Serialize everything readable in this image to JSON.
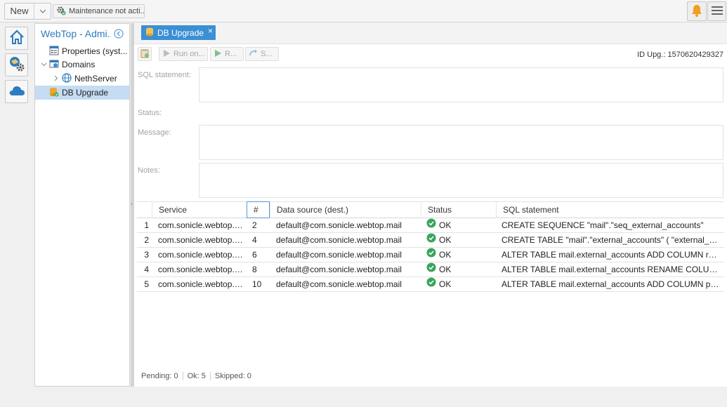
{
  "toolbar": {
    "new_label": "New",
    "maintenance_label": "Maintenance not acti..."
  },
  "launcher": {
    "items": [
      {
        "name": "home-icon"
      },
      {
        "name": "admin-icon"
      },
      {
        "name": "cloud-icon"
      }
    ]
  },
  "tree": {
    "title": "WebTop - Admi...",
    "nodes": [
      {
        "label": "Properties (syst...",
        "icon": "properties-icon"
      },
      {
        "label": "Domains",
        "icon": "domains-icon"
      },
      {
        "label": "NethServer",
        "icon": "globe-icon"
      },
      {
        "label": "DB Upgrade",
        "icon": "db-upgrade-icon"
      }
    ]
  },
  "tab": {
    "label": "DB Upgrade",
    "close_glyph": "×"
  },
  "actions": {
    "run_label": "Run on...",
    "r_label": "R...",
    "s_label": "S...",
    "id_upg": "ID Upg.: 1570620429327"
  },
  "form": {
    "sql_label": "SQL statement:",
    "status_label": "Status:",
    "message_label": "Message:",
    "notes_label": "Notes:"
  },
  "grid": {
    "columns": [
      "Service",
      "#",
      "Data source (dest.)",
      "Status",
      "SQL statement"
    ],
    "rows": [
      {
        "n": "1",
        "service": "com.sonicle.webtop.mail",
        "seq": "2",
        "ds": "default@com.sonicle.webtop.mail",
        "status": "OK",
        "sql": "CREATE SEQUENCE \"mail\".\"seq_external_accounts\""
      },
      {
        "n": "2",
        "service": "com.sonicle.webtop.mail",
        "seq": "4",
        "ds": "default@com.sonicle.webtop.mail",
        "status": "OK",
        "sql": "CREATE TABLE \"mail\".\"external_accounts\" ( \"external_accou..."
      },
      {
        "n": "3",
        "service": "com.sonicle.webtop.mail",
        "seq": "6",
        "ds": "default@com.sonicle.webtop.mail",
        "status": "OK",
        "sql": "ALTER TABLE mail.external_accounts ADD COLUMN reado..."
      },
      {
        "n": "4",
        "service": "com.sonicle.webtop.mail",
        "seq": "8",
        "ds": "default@com.sonicle.webtop.mail",
        "status": "OK",
        "sql": "ALTER TABLE mail.external_accounts RENAME COLUMN r..."
      },
      {
        "n": "5",
        "service": "com.sonicle.webtop.mail",
        "seq": "10",
        "ds": "default@com.sonicle.webtop.mail",
        "status": "OK",
        "sql": "ALTER TABLE mail.external_accounts ADD COLUMN provid..."
      }
    ]
  },
  "statusbar": {
    "pending": "Pending: 0",
    "ok": "Ok: 5",
    "skipped": "Skipped: 0"
  },
  "colors": {
    "accent": "#3b8fd4",
    "ok_green": "#3aa55d",
    "bell": "#f0a01e"
  }
}
